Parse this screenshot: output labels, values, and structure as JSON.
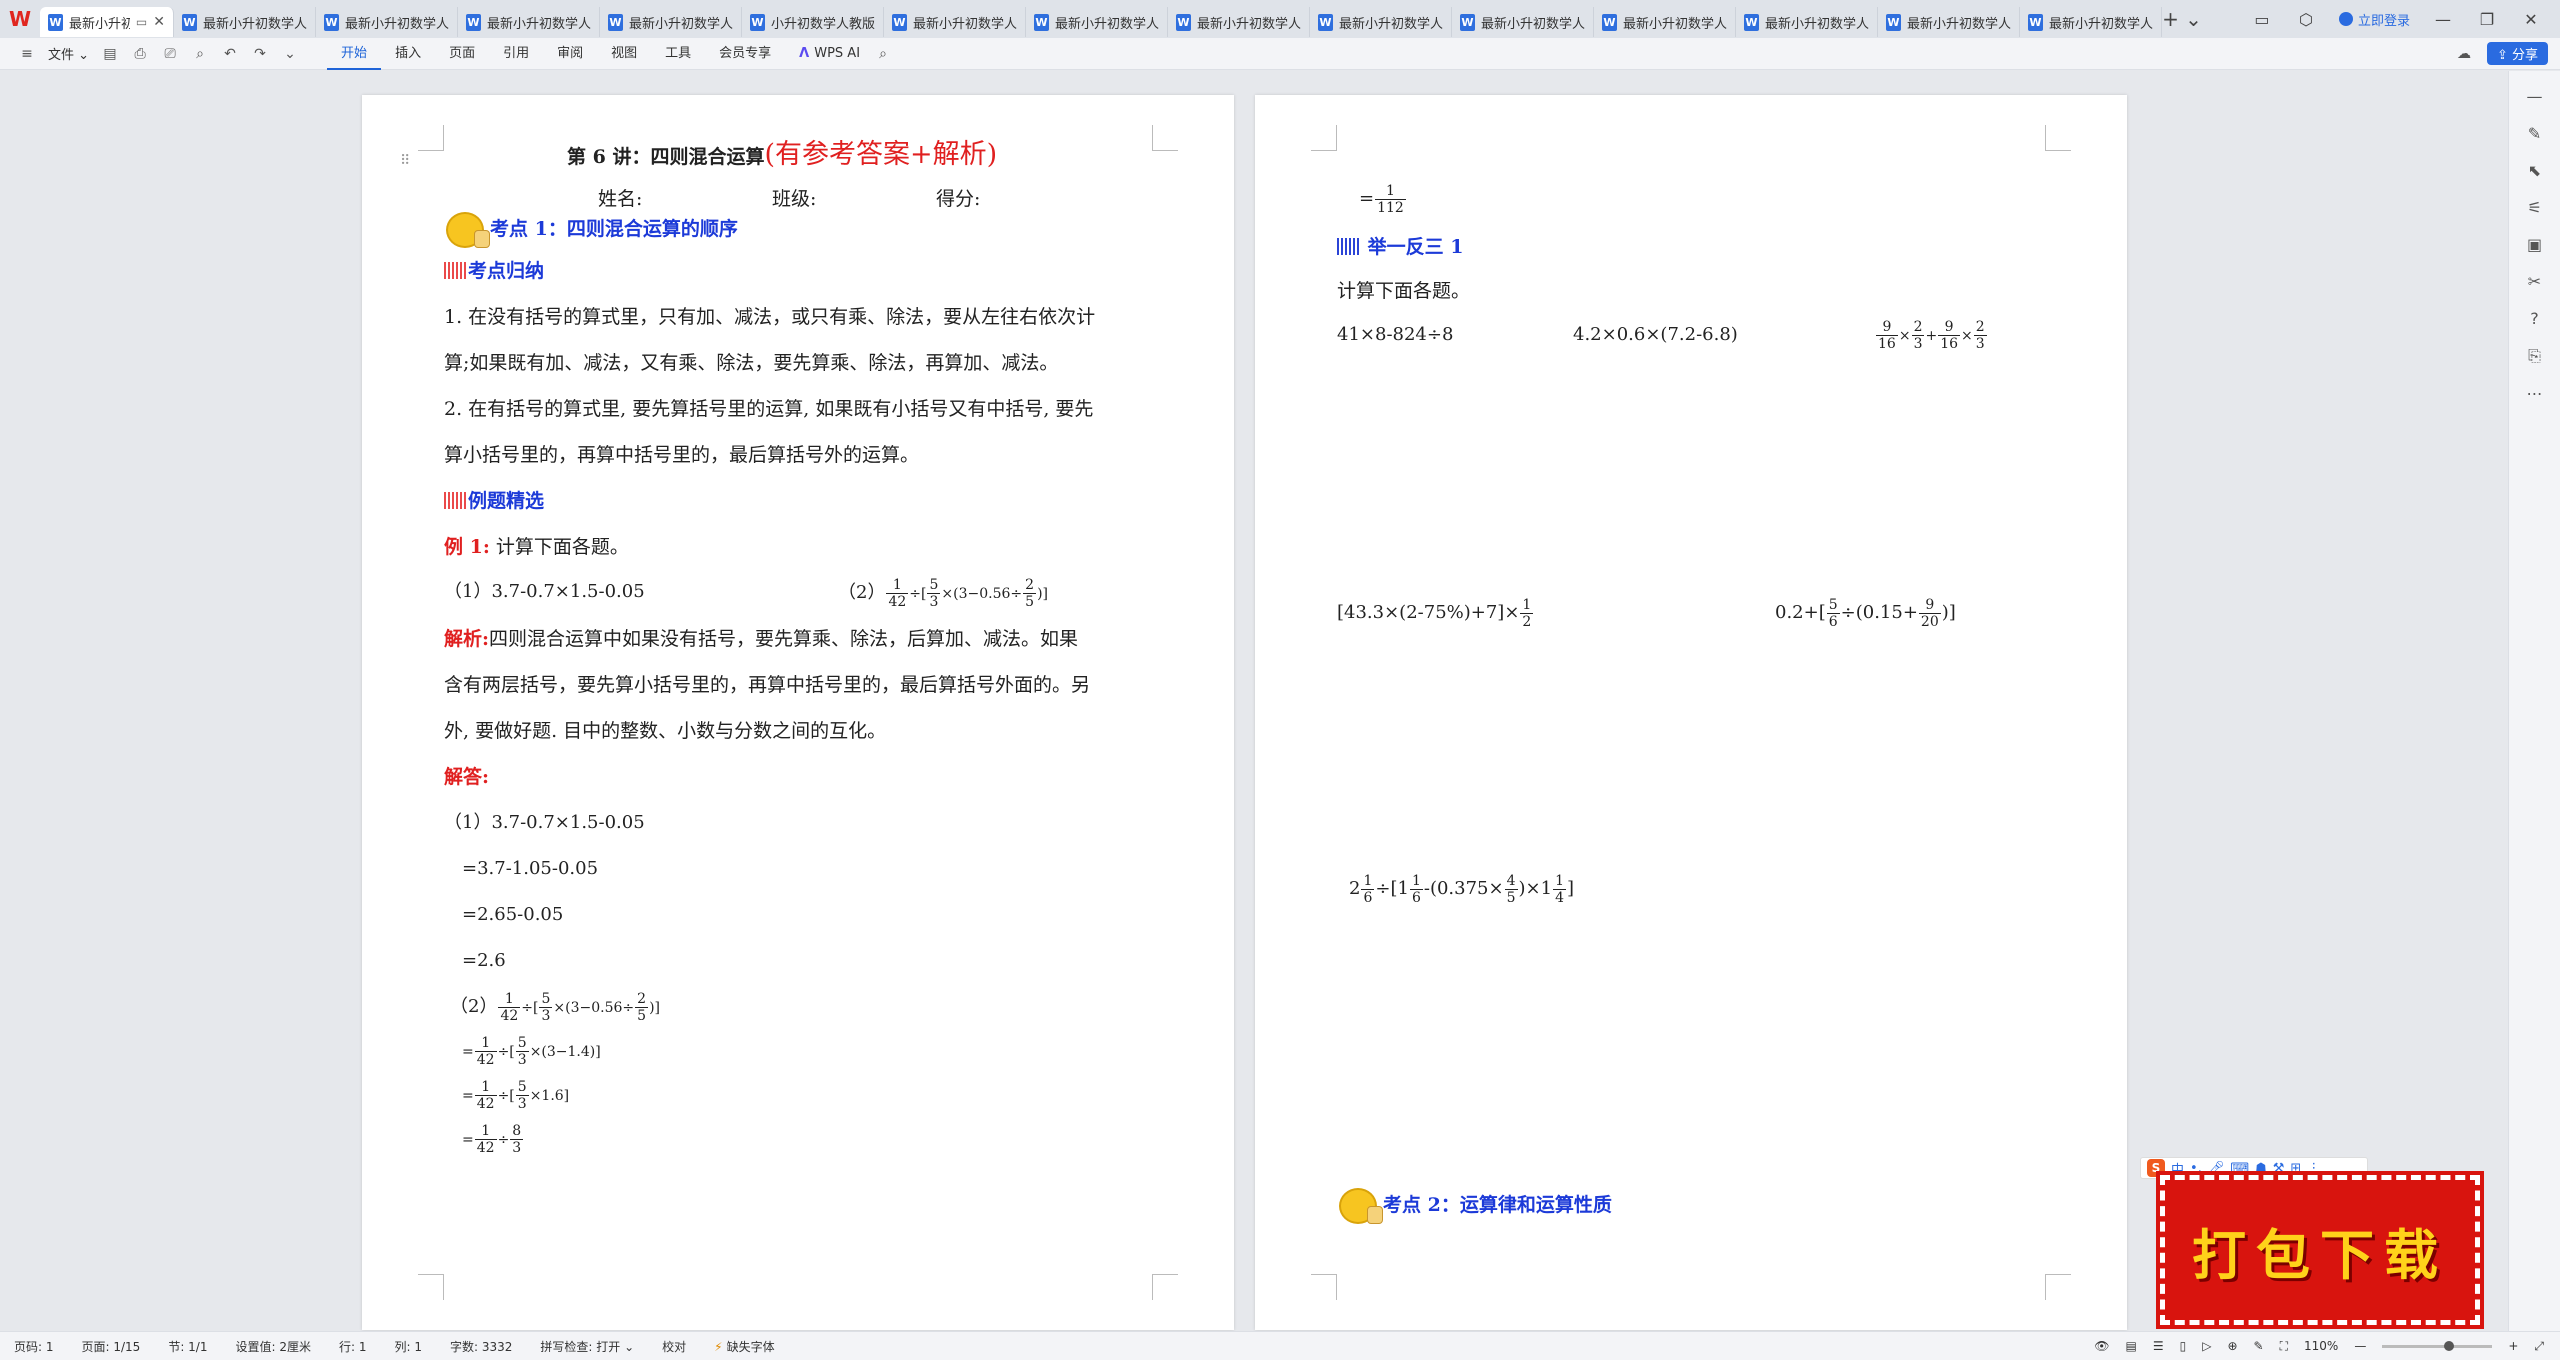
{
  "titlebar": {
    "logo": "W",
    "tabs": [
      {
        "label": "最新小升初",
        "active": true,
        "icon": "W"
      },
      {
        "label": "最新小升初数学人",
        "icon": "W"
      },
      {
        "label": "最新小升初数学人",
        "icon": "W"
      },
      {
        "label": "最新小升初数学人",
        "icon": "W"
      },
      {
        "label": "最新小升初数学人",
        "icon": "W"
      },
      {
        "label": "小升初数学人教版",
        "icon": "W"
      },
      {
        "label": "最新小升初数学人",
        "icon": "W"
      },
      {
        "label": "最新小升初数学人",
        "icon": "W"
      },
      {
        "label": "最新小升初数学人",
        "icon": "W"
      },
      {
        "label": "最新小升初数学人",
        "icon": "W"
      },
      {
        "label": "最新小升初数学人",
        "icon": "W"
      },
      {
        "label": "最新小升初数学人",
        "icon": "W"
      },
      {
        "label": "最新小升初数学人",
        "icon": "W"
      },
      {
        "label": "最新小升初数学人",
        "icon": "W"
      },
      {
        "label": "最新小升初数学人",
        "icon": "W"
      }
    ],
    "login_label": "立即登录"
  },
  "toolbar": {
    "file_label": "文件",
    "menu_tabs": [
      "开始",
      "插入",
      "页面",
      "引用",
      "审阅",
      "视图",
      "工具",
      "会员专享"
    ],
    "active_tab": "开始",
    "wps_ai_label": "WPS AI",
    "share_label": "分享"
  },
  "left_page": {
    "title_main": "第 6 讲：四则混合运算",
    "title_red": "(有参考答案+解析)",
    "name_label": "姓名:",
    "class_label": "班级:",
    "score_label": "得分:",
    "kaodian1": "考点 1：四则混合运算的顺序",
    "guina_heading": "考点归纳",
    "p1_l1": "1. 在没有括号的算式里，只有加、减法，或只有乘、除法，要从左往右依次计",
    "p1_l2": "算;如果既有加、减法，又有乘、除法，要先算乘、除法，再算加、减法。",
    "p2_l1": "2. 在有括号的算式里, 要先算括号里的运算, 如果既有小括号又有中括号, 要先",
    "p2_l2": "算小括号里的，再算中括号里的，最后算括号外的运算。",
    "liti_heading": "例题精选",
    "example_label": "例 1:",
    "example_text": "计算下面各题。",
    "q1": "（1）3.7-0.7×1.5-0.05",
    "q2_label": "（2）",
    "analysis_label": "解析:",
    "analysis_l1": "四则混合运算中如果没有括号，要先算乘、除法，后算加、减法。如果",
    "analysis_l2": "含有两层括号，要先算小括号里的，再算中括号里的，最后算括号外面的。另",
    "analysis_l3": "外, 要做好题. 目中的整数、小数与分数之间的互化。",
    "answer_label": "解答:",
    "s1_l1": "（1）3.7-0.7×1.5-0.05",
    "s1_l2": "=3.7-1.05-0.05",
    "s1_l3": "=2.65-0.05",
    "s1_l4": "=2.6",
    "s2_label": "（2）",
    "eq": "="
  },
  "right_page": {
    "top_eq": "=",
    "top_frac_n": "1",
    "top_frac_d": "112",
    "jyfs_heading": "举一反三 1",
    "instr": "计算下面各题。",
    "e1": "41×8-824÷8",
    "e2": "4.2×0.6×(7.2-6.8)",
    "e4_prefix": "[43.3×(2-75%)+7]×",
    "e5_prefix": "0.2+[",
    "e5_mid": "÷(0.15+",
    "e5_suffix": ")]",
    "e6_whole": "2",
    "e6_mid": "÷[1",
    "e6_mid2": "-(0.375×",
    "e6_mid3": ")×1",
    "e6_suffix": "]",
    "kaodian2": "考点 2：运算律和运算性质"
  },
  "banner": {
    "ime_label": "中",
    "download_text": "打包下载"
  },
  "statusbar": {
    "page": "页码: 1",
    "pages": "页面: 1/15",
    "section": "节: 1/1",
    "setting": "设置值: 2厘米",
    "row": "行: 1",
    "col": "列: 1",
    "words": "字数: 3332",
    "spell": "拼写检查: 打开",
    "proof": "校对",
    "missing_font": "缺失字体",
    "zoom": "110%"
  }
}
